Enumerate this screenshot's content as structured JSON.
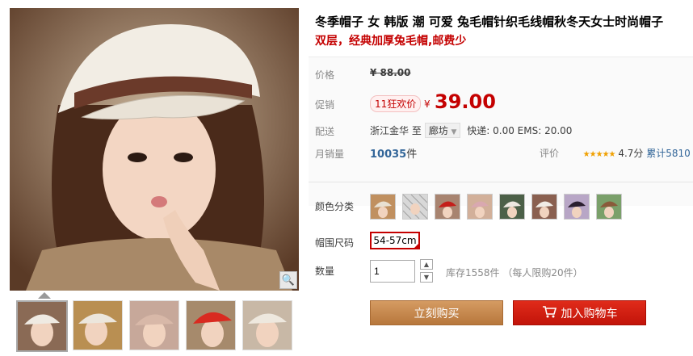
{
  "product": {
    "title": "冬季帽子 女 韩版 潮 可爱 兔毛帽针织毛线帽秋冬天女士时尚帽子",
    "subtitle": "双层，经典加厚兔毛帽,邮费少"
  },
  "price": {
    "label": "价格",
    "original": "¥ 88.00",
    "promo_label": "促销",
    "promo_tag": "11狂欢价",
    "currency": "¥",
    "current": "39.00"
  },
  "shipping": {
    "label": "配送",
    "from": "浙江金华",
    "to_word": "至",
    "to_city": "廊坊",
    "fees": "快递: 0.00 EMS: 20.00"
  },
  "sales": {
    "label": "月销量",
    "count": "10035",
    "unit": "件",
    "rating_label": "评价",
    "stars": "★★★★★",
    "score": "4.7分",
    "cumulative": "累计5810"
  },
  "options": {
    "color_label": "颜色分类",
    "size_label": "帽围尺码",
    "size_value": "54-57cm",
    "qty_label": "数量",
    "qty_value": "1",
    "stock": "库存1558件 （每人限购20件）"
  },
  "buttons": {
    "buy": "立刻购买",
    "cart": "加入购物车"
  },
  "colors": {
    "accent": "#c40000",
    "buy_button": "#c68a4f",
    "cart_button": "#c81a0e"
  }
}
